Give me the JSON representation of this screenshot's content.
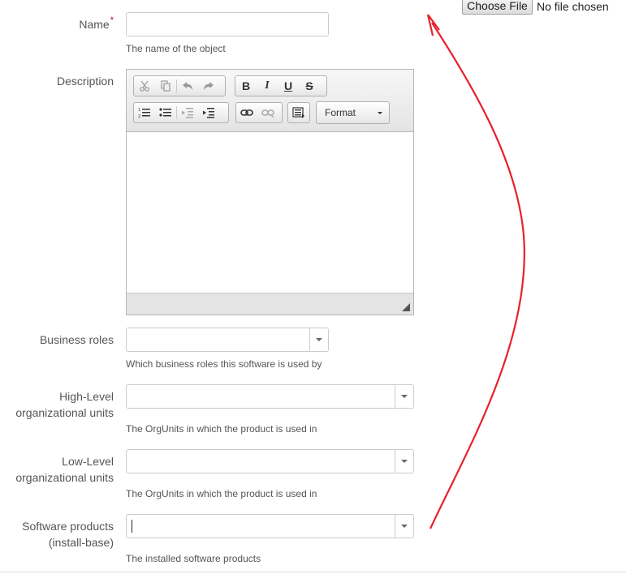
{
  "file": {
    "button_label": "Choose File",
    "status": "No file chosen"
  },
  "name": {
    "label": "Name",
    "required_mark": "*",
    "value": "",
    "help": "The name of the object"
  },
  "description": {
    "label": "Description",
    "toolbar": {
      "cut_icon": "scissors-icon",
      "copy_icon": "copy-icon",
      "undo_icon": "undo-icon",
      "redo_icon": "redo-icon",
      "bold": "B",
      "italic": "I",
      "underline": "U",
      "strike": "S",
      "format_label": "Format"
    }
  },
  "business_roles": {
    "label": "Business roles",
    "help": "Which business roles this software is used by"
  },
  "high_level": {
    "label_line1": "High-Level",
    "label_line2": "organizational units",
    "help": "The OrgUnits in which the product is used in"
  },
  "low_level": {
    "label_line1": "Low-Level",
    "label_line2": "organizational units",
    "help": "The OrgUnits in which the product is used in"
  },
  "software_products": {
    "label_line1": "Software products",
    "label_line2": "(install-base)",
    "help": "The installed software products"
  },
  "colors": {
    "annotation_arrow": "#e8212a",
    "required": "#cc0000"
  }
}
